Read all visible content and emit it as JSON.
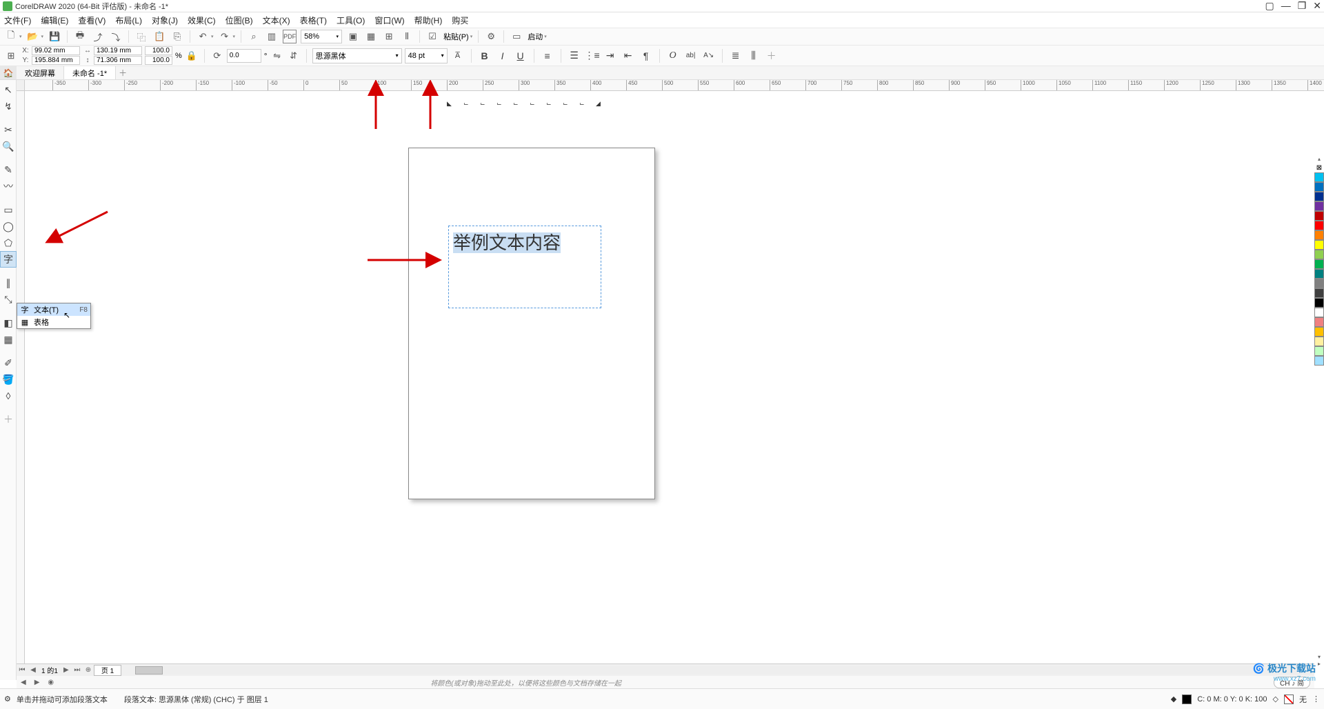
{
  "titlebar": {
    "title": "CorelDRAW 2020 (64-Bit 评估版) - 未命名 -1*"
  },
  "menu": {
    "file": "文件(F)",
    "edit": "编辑(E)",
    "view": "查看(V)",
    "layout": "布局(L)",
    "object": "对象(J)",
    "effects": "效果(C)",
    "bitmap": "位图(B)",
    "text": "文本(X)",
    "table": "表格(T)",
    "tools": "工具(O)",
    "window": "窗口(W)",
    "help": "帮助(H)",
    "buy": "购买"
  },
  "toolbar1": {
    "zoom": "58%",
    "paste": "粘贴(P)",
    "launch": "启动"
  },
  "propbar": {
    "x_label": "X:",
    "y_label": "Y:",
    "x": "99.02 mm",
    "y": "195.884 mm",
    "w": "130.19 mm",
    "h": "71.306 mm",
    "sx": "100.0",
    "sy": "100.0",
    "pct": "%",
    "rot": "0.0",
    "deg": "°",
    "font": "思源黑体",
    "size": "48 pt"
  },
  "tabs": {
    "welcome": "欢迎屏幕",
    "doc": "未命名 -1*"
  },
  "flyout": {
    "text_label": "文本(T)",
    "text_shortcut": "F8",
    "table_label": "表格"
  },
  "canvas": {
    "sample_text": "举例文本内容"
  },
  "page_tabs": {
    "counter": "的1",
    "page1": "页 1"
  },
  "hints": {
    "drag_hint": "将颜色(或对象)拖动至此处，以便将这些颜色与文档存储在一起",
    "ime": "CH ♪ 简"
  },
  "status": {
    "left1": "单击并拖动可添加段落文本",
    "left2": "段落文本: 思源黑体 (常规) (CHC) 于 图层 1",
    "cmyk": "C: 0 M: 0 Y: 0 K: 100",
    "none": "无"
  },
  "watermark": {
    "name": "极光下载站",
    "url": "www.xz7.com"
  },
  "palette_colors": [
    "#00c0f0",
    "#0070c0",
    "#003090",
    "#7030a0",
    "#c00000",
    "#ff0000",
    "#ff8000",
    "#ffff00",
    "#90d050",
    "#00b050",
    "#008080",
    "#808080",
    "#404040",
    "#000000",
    "#ffffff",
    "#f08080",
    "#ffc000",
    "#fff0a0",
    "#c0ffc0",
    "#a0e0ff"
  ],
  "ruler_ticks": [
    -350,
    -300,
    -250,
    -200,
    -150,
    -100,
    -50,
    0,
    50,
    100,
    150,
    200,
    250,
    300,
    350,
    400,
    450,
    500,
    550,
    600,
    650,
    700,
    750,
    800,
    850,
    900,
    950,
    1000,
    1050,
    1100,
    1150,
    1200,
    1250,
    1300,
    1350,
    1400
  ]
}
